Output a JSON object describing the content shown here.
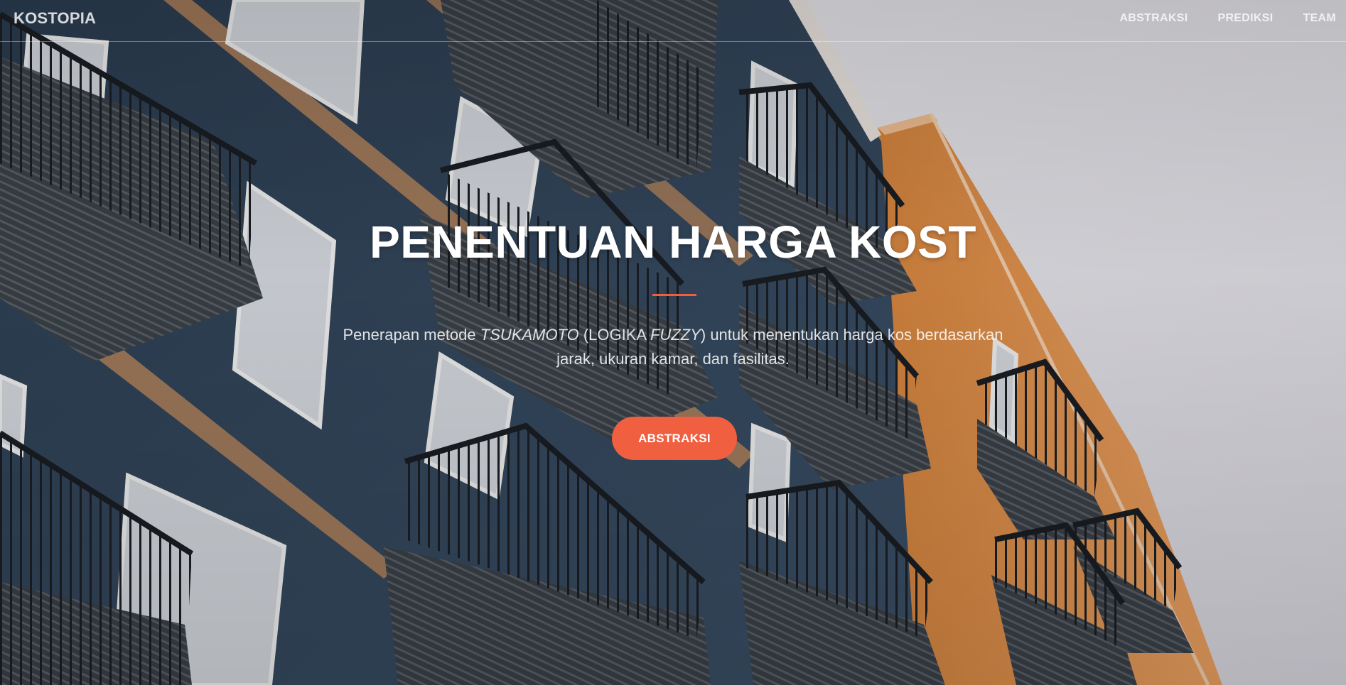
{
  "navbar": {
    "brand": "KOSTOPIA",
    "links": [
      {
        "label": "ABSTRAKSI"
      },
      {
        "label": "PREDIKSI"
      },
      {
        "label": "TEAM"
      }
    ]
  },
  "hero": {
    "title": "PENENTUAN HARGA KOST",
    "subtitle": {
      "part1": "Penerapan metode ",
      "method": "TSUKAMOTO",
      "part2": " (LOGIKA ",
      "fuzzy": "FUZZY",
      "part3": ") untuk menentukan harga kos berdasarkan jarak, ukuran kamar, dan fasilitas."
    },
    "button_label": "ABSTRAKSI"
  },
  "colors": {
    "accent": "#f05f40",
    "building_blue": "#34495e",
    "building_orange": "#e8914a",
    "sky": "#e9e9ee"
  }
}
